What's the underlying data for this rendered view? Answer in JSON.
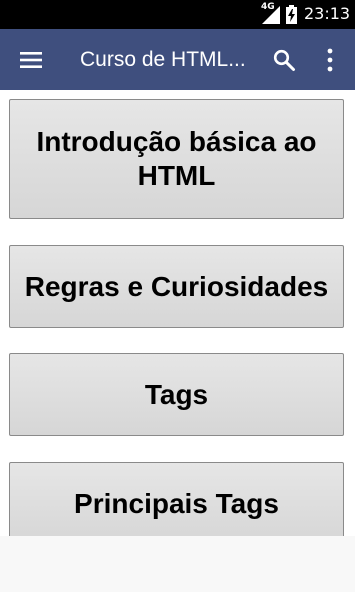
{
  "status_bar": {
    "network_label": "4G",
    "time": "23:13",
    "icons": [
      "signal-icon",
      "battery-charging-icon"
    ]
  },
  "app_bar": {
    "title": "Curso de HTML...",
    "background_color": "#3f4f7e",
    "icons": [
      "menu-icon",
      "search-icon",
      "more-vertical-icon"
    ]
  },
  "topics": [
    {
      "label": "Introdução básica ao HTML"
    },
    {
      "label": "Regras e Curiosidades"
    },
    {
      "label": "Tags"
    },
    {
      "label": "Principais Tags"
    }
  ]
}
